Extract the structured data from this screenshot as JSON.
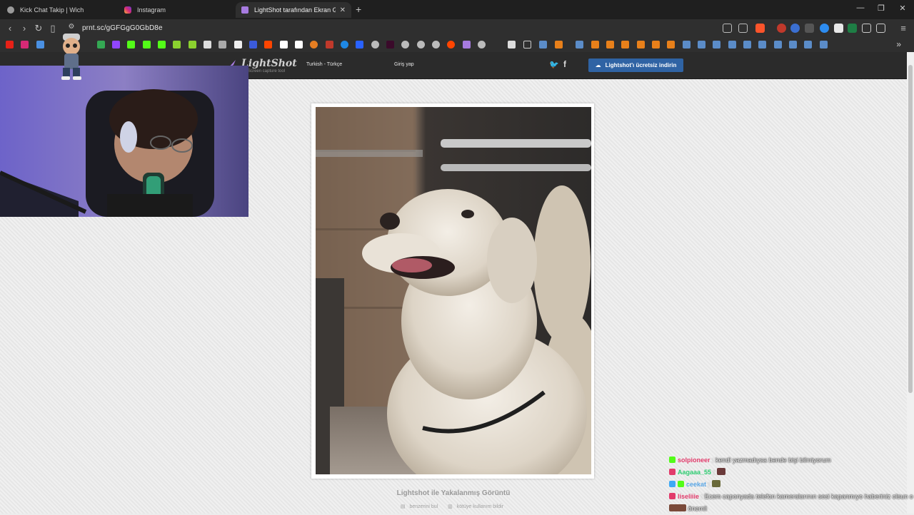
{
  "browser": {
    "tabs": [
      {
        "title": "Kick Chat Takip | Wich",
        "active": false,
        "icon": "globe-icon"
      },
      {
        "title": "Instagram",
        "active": false,
        "icon": "instagram-icon"
      },
      {
        "title": "LightShot tarafından Ekran Görü",
        "active": true,
        "icon": "lightshot-feather-icon"
      }
    ],
    "new_tab": "+",
    "url": "prnt.sc/gGFGgG0GbD8e"
  },
  "lightshot": {
    "logo": "LightShot",
    "tagline": "Screen capture tool",
    "language": "Turkish - Türkçe",
    "login": "Giriş yap",
    "download_button": "Lightshot'ı ücretsiz indirin",
    "screenshot_title": "Lightshot ile Yakalanmış Görüntü",
    "find_similar": "benzerini bul",
    "report_abuse": "kötüye kullanım bildir"
  },
  "chat": {
    "messages": [
      {
        "user": "solpioneer",
        "user_color": "#e23b6b",
        "text": "kendi yazmadıysa bende bişi bilmiyorum"
      },
      {
        "user": "Aagaaa_55",
        "user_color": "#2ecc71",
        "text": ""
      },
      {
        "user": "ceekat",
        "user_color": "#5aa7e6",
        "text": ""
      },
      {
        "user": "liseliiie",
        "user_color": "#e23b6b",
        "text": "Ecem caponyada telefon kameralarının sesi kapanmıyo haberiniz olsun o",
        "text2": "önemli"
      }
    ]
  },
  "colors": {
    "download_button": "#2f63a4",
    "header": "#2b2b2b",
    "tabbar": "#1f1f1f",
    "toolbar": "#2f2f2f"
  }
}
